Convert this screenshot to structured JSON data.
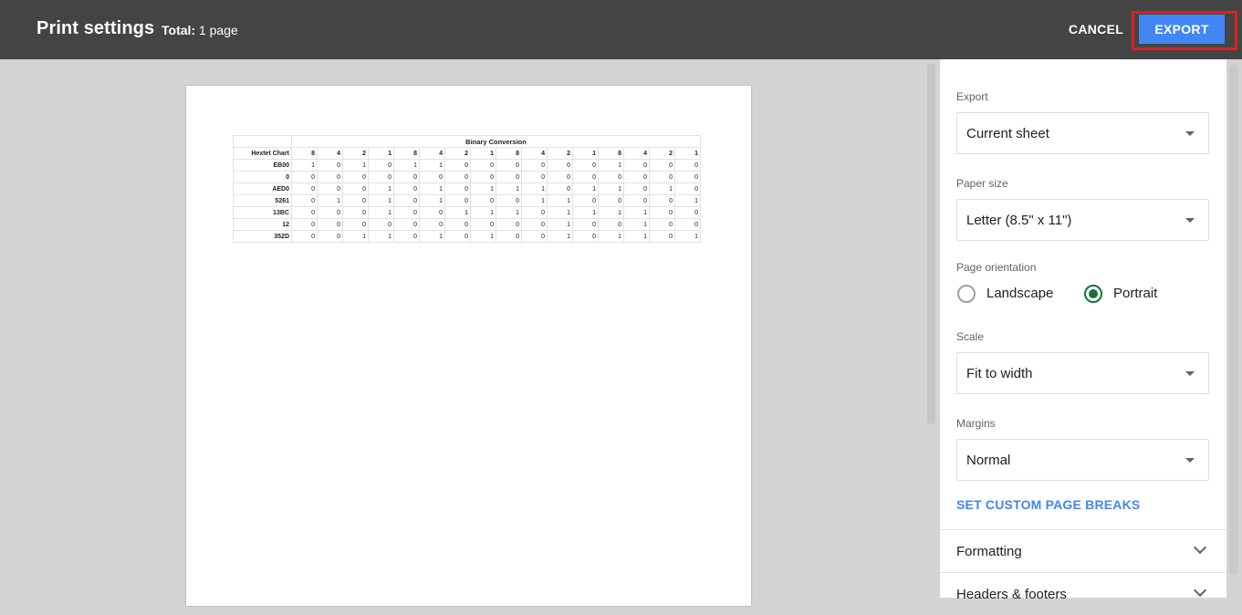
{
  "header": {
    "title": "Print settings",
    "total_label": "Total:",
    "total_value": "1 page",
    "cancel_label": "CANCEL",
    "export_label": "EXPORT"
  },
  "sheet": {
    "title": "Binary Conversion",
    "column_header": "Hextet Chart",
    "bit_headers": [
      "8",
      "4",
      "2",
      "1",
      "8",
      "4",
      "2",
      "1",
      "8",
      "4",
      "2",
      "1",
      "8",
      "4",
      "2",
      "1"
    ],
    "rows": [
      {
        "label": "EB00",
        "bits": [
          "1",
          "0",
          "1",
          "0",
          "1",
          "1",
          "0",
          "0",
          "0",
          "0",
          "0",
          "0",
          "1",
          "0",
          "0",
          "0"
        ]
      },
      {
        "label": "0",
        "bits": [
          "0",
          "0",
          "0",
          "0",
          "0",
          "0",
          "0",
          "0",
          "0",
          "0",
          "0",
          "0",
          "0",
          "0",
          "0",
          "0"
        ]
      },
      {
        "label": "AED0",
        "bits": [
          "0",
          "0",
          "0",
          "1",
          "0",
          "1",
          "0",
          "1",
          "1",
          "1",
          "0",
          "1",
          "1",
          "0",
          "1",
          "0"
        ]
      },
      {
        "label": "5261",
        "bits": [
          "0",
          "1",
          "0",
          "1",
          "0",
          "1",
          "0",
          "0",
          "0",
          "1",
          "1",
          "0",
          "0",
          "0",
          "0",
          "1"
        ]
      },
      {
        "label": "13BC",
        "bits": [
          "0",
          "0",
          "0",
          "1",
          "0",
          "0",
          "1",
          "1",
          "1",
          "0",
          "1",
          "1",
          "1",
          "1",
          "0",
          "0"
        ]
      },
      {
        "label": "12",
        "bits": [
          "0",
          "0",
          "0",
          "0",
          "0",
          "0",
          "0",
          "0",
          "0",
          "0",
          "1",
          "0",
          "0",
          "1",
          "0",
          "0"
        ]
      },
      {
        "label": "352D",
        "bits": [
          "0",
          "0",
          "1",
          "1",
          "0",
          "1",
          "0",
          "1",
          "0",
          "0",
          "1",
          "0",
          "1",
          "1",
          "0",
          "1"
        ]
      }
    ]
  },
  "settings": {
    "export": {
      "label": "Export",
      "value": "Current sheet"
    },
    "paper_size": {
      "label": "Paper size",
      "value": "Letter (8.5\" x 11\")"
    },
    "orientation": {
      "label": "Page orientation",
      "options": [
        "Landscape",
        "Portrait"
      ],
      "selected": "Portrait"
    },
    "scale": {
      "label": "Scale",
      "value": "Fit to width"
    },
    "margins": {
      "label": "Margins",
      "value": "Normal"
    },
    "custom_breaks_label": "SET CUSTOM PAGE BREAKS",
    "sections": [
      "Formatting",
      "Headers & footers"
    ]
  },
  "colors": {
    "header_bg": "#444444",
    "export_button": "#4285f4",
    "highlight_outline": "#e51c23",
    "radio_selected": "#137333",
    "link": "#4285f4"
  }
}
